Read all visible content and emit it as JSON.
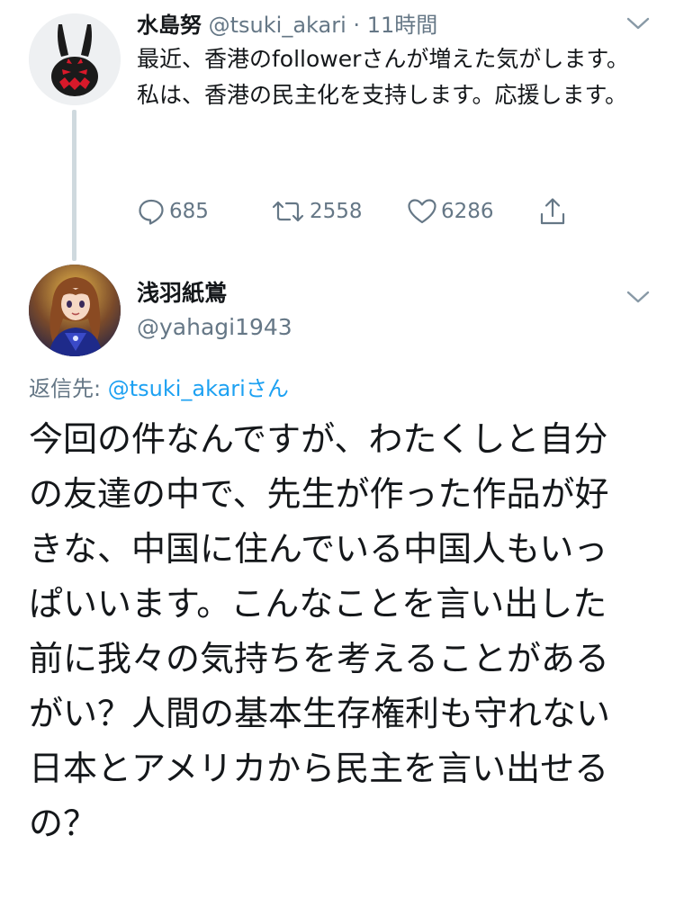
{
  "parent_tweet": {
    "display_name": "水島努",
    "handle": "@tsuki_akari",
    "separator": "·",
    "timestamp": "11時間",
    "text_lines": [
      "最近、香港のfollowerさんが増えた気がします。",
      "私は、香港の民主化を支持します。応援します。"
    ],
    "actions": {
      "reply_count": "685",
      "retweet_count": "2558",
      "like_count": "6286"
    }
  },
  "reply_tweet": {
    "display_name": "浅羽紙鴬",
    "handle": "@yahagi1943",
    "reply_to_prefix": "返信先: ",
    "reply_to_user": "@tsuki_akariさん",
    "body": "今回の件なんですが、わたくしと自分の友達の中で、先生が作った作品が好きな、中国に住んでいる中国人もいっぱいいます。こんなことを言い出した前に我々の気持ちを考えることがあるがい？人間の基本生存権利も守れない日本とアメリカから民主を言い出せるの？"
  },
  "colors": {
    "text_primary": "#14171a",
    "text_secondary": "#657786",
    "link": "#1da1f2",
    "thread_line": "#cfd9de"
  }
}
